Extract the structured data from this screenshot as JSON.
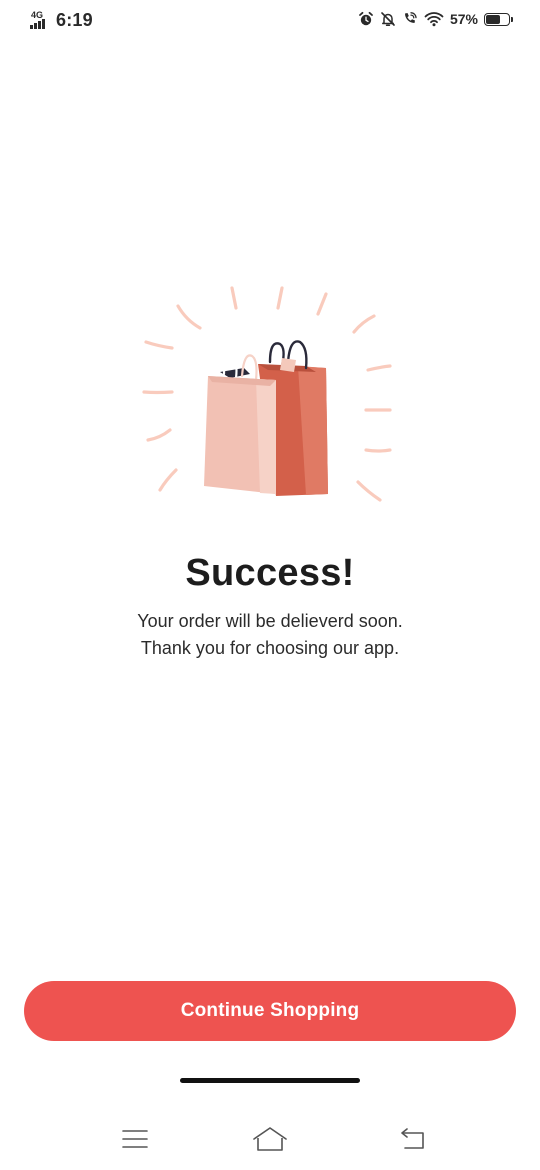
{
  "status_bar": {
    "network": "4G",
    "time": "6:19",
    "battery_percent": "57%",
    "battery_level": 0.57,
    "icons": [
      "signal-icon",
      "alarm-icon",
      "mute-icon",
      "wifi-calling-icon",
      "wifi-icon",
      "battery-icon"
    ]
  },
  "illustration": {
    "icon": "shopping-bags-icon",
    "colors": {
      "accent_lines": "#f9cbbd",
      "bag_light": "#f2c1b4",
      "bag_dark": "#d3604a",
      "handle": "#2a2a3a"
    }
  },
  "success": {
    "title": "Success!",
    "message_line1": "Your order will be delieverd soon.",
    "message_line2": "Thank you for choosing our app."
  },
  "actions": {
    "continue_label": "Continue Shopping"
  },
  "nav": {
    "items": [
      "menu-icon",
      "home-icon",
      "back-icon"
    ]
  },
  "theme": {
    "accent": "#ee5350",
    "background": "#ffffff",
    "text": "#1d1d1d"
  }
}
